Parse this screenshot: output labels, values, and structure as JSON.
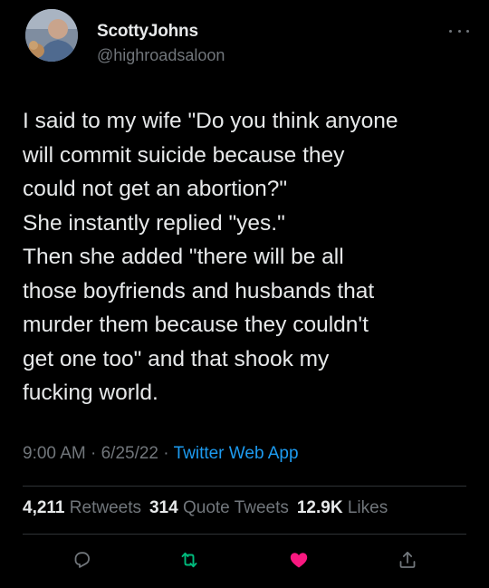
{
  "tweet": {
    "display_name": "ScottyJohns",
    "handle": "@highroadsaloon",
    "more_icon": "more-dots-icon",
    "body_lines": [
      "I said to my wife \"Do you think anyone",
      "will commit suicide because they",
      "could not get an abortion?\"",
      "She instantly replied \"yes.\"",
      "Then she added \"there will be all",
      "those boyfriends and husbands that",
      "murder them because they couldn't",
      "get one too\" and that shook my",
      "fucking world."
    ],
    "time": "9:00 AM",
    "separator": "·",
    "date": "6/25/22",
    "source": "Twitter Web App"
  },
  "stats": {
    "retweets_count": "4,211",
    "retweets_label": "Retweets",
    "quotes_count": "314",
    "quotes_label": "Quote Tweets",
    "likes_count": "12.9K",
    "likes_label": "Likes"
  },
  "actions": {
    "reply_icon": "reply-icon",
    "retweet_icon": "retweet-icon",
    "like_icon": "heart-icon",
    "share_icon": "share-icon"
  },
  "colors": {
    "background": "#000000",
    "text": "#e7e9ea",
    "muted": "#71767b",
    "link": "#1d9bf0",
    "retweet": "#00ba7c",
    "like": "#f91880"
  }
}
